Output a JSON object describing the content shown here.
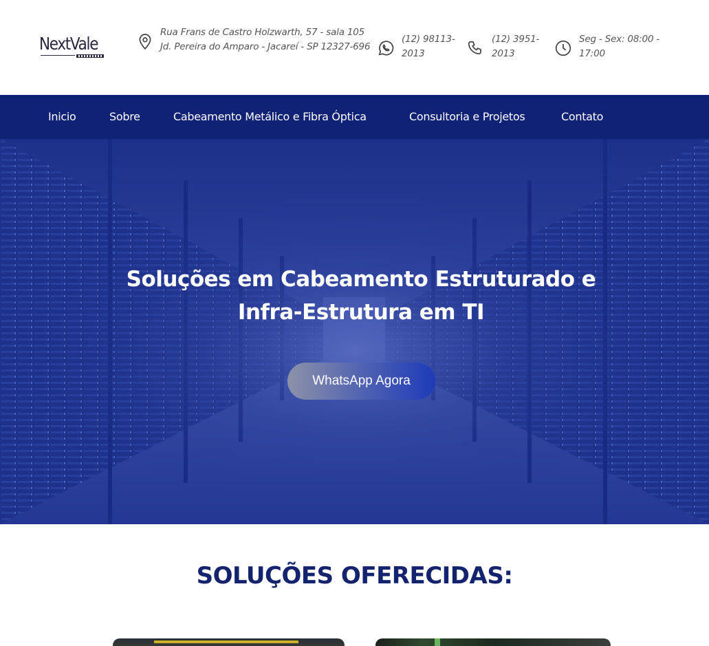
{
  "brand": {
    "name": "NextVale"
  },
  "contact": {
    "address": "Rua Frans de Castro Holzwarth, 57 - sala 105 Jd. Pereira do Amparo - Jacareí - SP 12327-696",
    "whatsapp": "(12) 98113-2013",
    "phone": "(12) 3951-2013",
    "hours": "Seg - Sex: 08:00 - 17:00"
  },
  "nav": {
    "items": [
      {
        "label": "Inicio"
      },
      {
        "label": "Sobre"
      },
      {
        "label": "Cabeamento Metálico e Fibra Óptica"
      },
      {
        "label": "Consultoria e Projetos"
      },
      {
        "label": "Contato"
      }
    ]
  },
  "hero": {
    "title": "Soluções em Cabeamento Estruturado e Infra-Estrutura em TI",
    "cta_label": "WhatsApp Agora"
  },
  "solutions": {
    "title": "SOLUÇÕES OFERECIDAS:"
  },
  "colors": {
    "nav_bg": "#0f2275",
    "hero_overlay": "#253a94",
    "section_title": "#14236e",
    "text_muted": "#555555"
  },
  "icons": {
    "address": "map-pin-icon",
    "whatsapp": "whatsapp-icon",
    "phone": "phone-icon",
    "hours": "clock-icon"
  }
}
